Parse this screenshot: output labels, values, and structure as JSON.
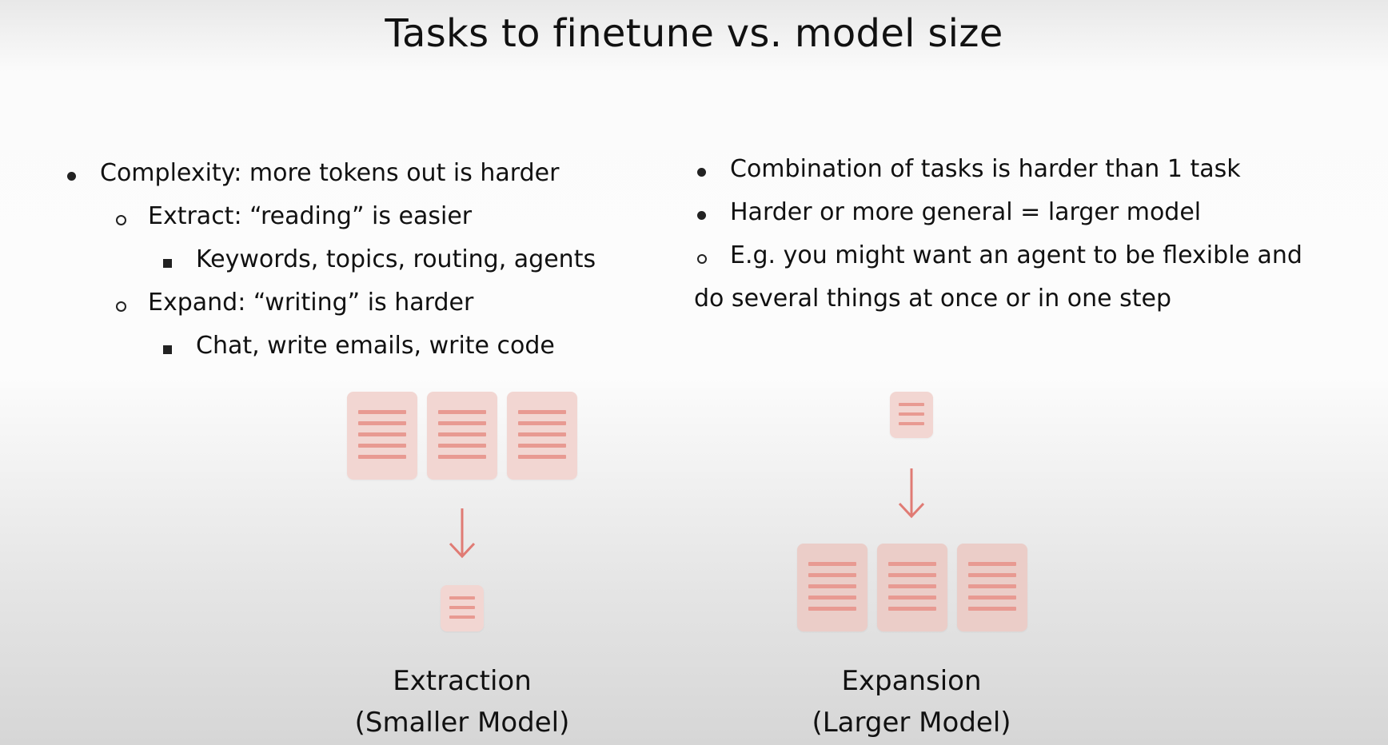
{
  "title": "Tasks to finetune vs. model size",
  "left_bullets": [
    {
      "text": "Complexity: more tokens out is harder"
    },
    {
      "text": "Extract: “reading” is easier"
    },
    {
      "text": "Keywords, topics, routing, agents"
    },
    {
      "text": "Expand: “writing” is harder"
    },
    {
      "text": "Chat, write emails, write code"
    }
  ],
  "right_bullets": [
    {
      "text": "Combination of tasks is harder than 1 task"
    },
    {
      "text": "Harder or more general = larger model"
    },
    {
      "text": "E.g. you might want an agent to be flexible and"
    },
    {
      "text": "do several things at once or in one step"
    }
  ],
  "diagrams": {
    "extraction": {
      "caption_line1": "Extraction",
      "caption_line2": "(Smaller Model)"
    },
    "expansion": {
      "caption_line1": "Expansion",
      "caption_line2": "(Larger Model)"
    }
  },
  "colors": {
    "doc_fill": "#f2d6d2",
    "doc_lines": "#e89a92",
    "arrow": "#e07b74"
  }
}
